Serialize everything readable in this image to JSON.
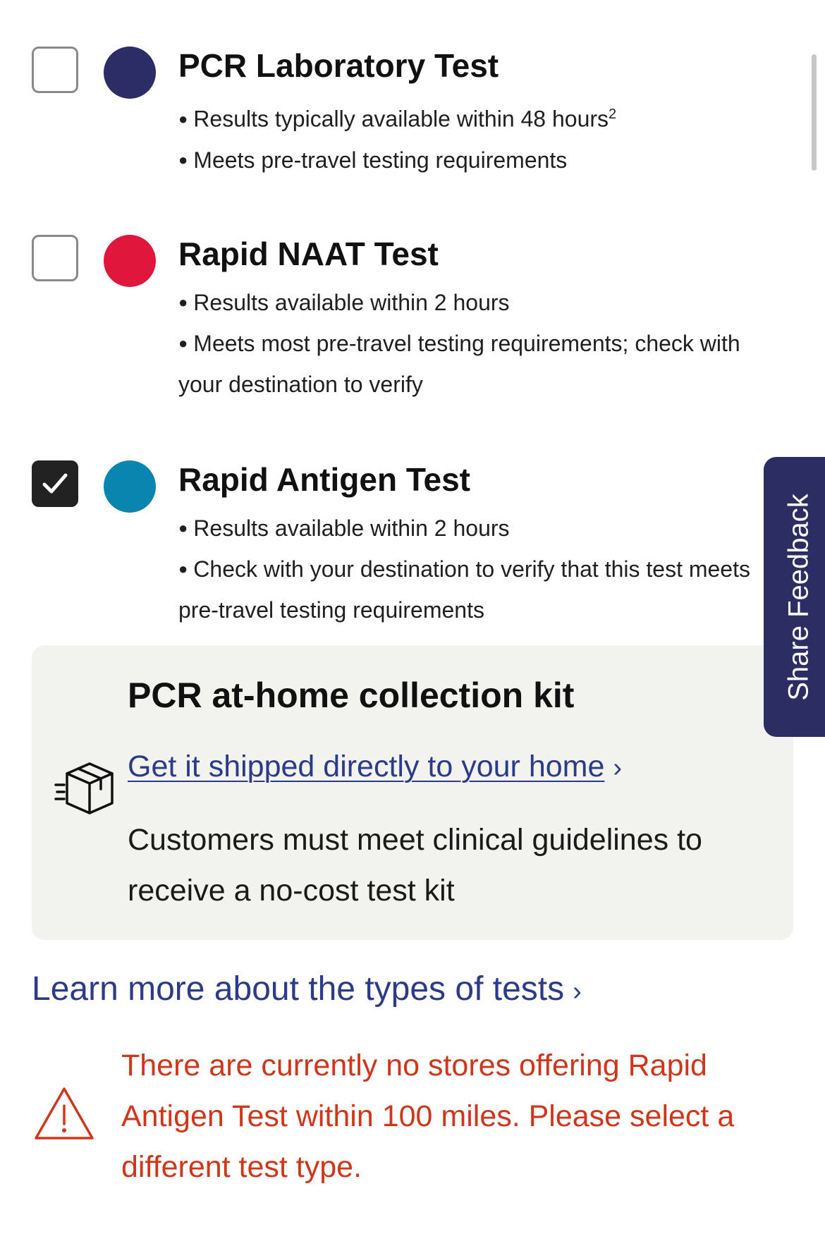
{
  "test_options": [
    {
      "title": "PCR Laboratory Test",
      "checked": false,
      "dot_color": "#2c2c66",
      "bullets": [
        "Results typically available within 48 hours",
        "Meets pre-travel testing requirements"
      ],
      "footnote": "2"
    },
    {
      "title": "Rapid NAAT Test",
      "checked": false,
      "dot_color": "#e0163c",
      "bullets": [
        "Results available within 2 hours",
        "Meets most pre-travel testing requirements; check with your destination to verify"
      ]
    },
    {
      "title": "Rapid Antigen Test",
      "checked": true,
      "dot_color": "#0a85b0",
      "bullets": [
        "Results available within 2 hours",
        "Check with your destination to verify that this test meets pre-travel testing requirements"
      ]
    }
  ],
  "kit": {
    "title": "PCR at-home collection kit",
    "icon": "package-box-icon",
    "link_label": "Get it shipped directly to your home",
    "note": "Customers must meet clinical guidelines to receive a no-cost test kit"
  },
  "learn_more_label": "Learn more about the types of tests",
  "warning": {
    "icon": "warning-triangle-icon",
    "message": "There are currently no stores offering Rapid Antigen Test within 100 miles. Please select a different test type."
  },
  "feedback_tab_label": "Share Feedback",
  "colors": {
    "link": "#2b3a8a",
    "warning": "#d2361a",
    "feedback_tab": "#2b2d63",
    "card_bg": "#f2f2ef"
  }
}
